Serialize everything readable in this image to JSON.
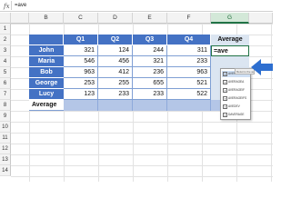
{
  "formula_bar": {
    "fx": "fx",
    "content": "=ave"
  },
  "columns": [
    "B",
    "C",
    "D",
    "E",
    "F",
    "G"
  ],
  "active_column": "G",
  "rows": [
    "1",
    "2",
    "3",
    "4",
    "5",
    "6",
    "7",
    "8",
    "9",
    "10",
    "11",
    "12",
    "13",
    "14"
  ],
  "table": {
    "headers": [
      "Q1",
      "Q2",
      "Q3",
      "Q4",
      "Average"
    ],
    "data": [
      {
        "name": "John",
        "values": [
          "321",
          "124",
          "244",
          "311"
        ],
        "avg": "=ave"
      },
      {
        "name": "Maria",
        "values": [
          "546",
          "456",
          "321",
          "233"
        ],
        "avg": ""
      },
      {
        "name": "Bob",
        "values": [
          "963",
          "412",
          "236",
          "963"
        ],
        "avg": ""
      },
      {
        "name": "George",
        "values": [
          "253",
          "255",
          "655",
          "521"
        ],
        "avg": ""
      },
      {
        "name": "Lucy",
        "values": [
          "123",
          "233",
          "233",
          "522"
        ],
        "avg": ""
      }
    ],
    "footer_label": "Average"
  },
  "autocomplete": {
    "items": [
      "AVERAGE",
      "AVERAGEA",
      "AVERAGEIF",
      "AVERAGEIFS",
      "AVEDEV",
      "DAVERAGE"
    ],
    "selected": 0,
    "tooltip": "Returns the ave..."
  },
  "colors": {
    "header": "#4472c4",
    "accent": "#217346",
    "arrow": "#2e6fd0",
    "avg_fill": "#b4c6e7"
  }
}
